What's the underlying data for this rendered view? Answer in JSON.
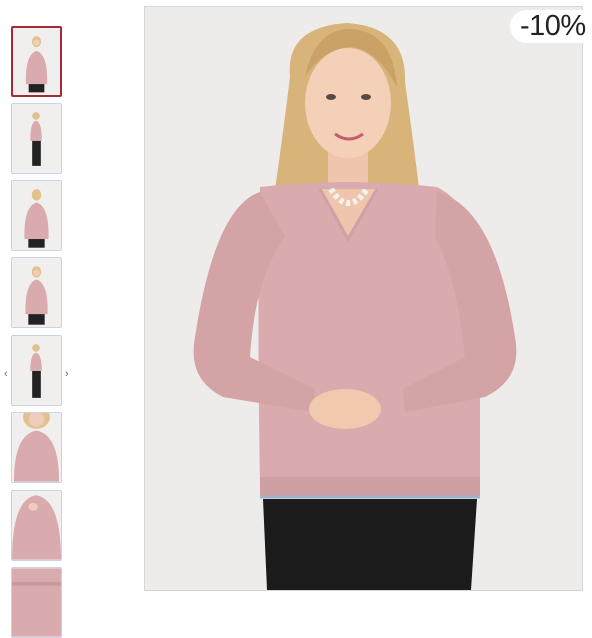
{
  "gallery": {
    "thumbnails": [
      {
        "alt": "thumb-1",
        "active": true
      },
      {
        "alt": "thumb-2",
        "active": false
      },
      {
        "alt": "thumb-3",
        "active": false
      },
      {
        "alt": "thumb-4",
        "active": false
      },
      {
        "alt": "thumb-5",
        "active": false
      },
      {
        "alt": "thumb-6",
        "active": false
      },
      {
        "alt": "thumb-7",
        "active": false
      },
      {
        "alt": "thumb-8",
        "active": false
      }
    ],
    "prev_arrow": "‹",
    "next_arrow": "›"
  },
  "product": {
    "discount_badge": "-10%"
  },
  "colors": {
    "sweater": "#d9abae",
    "background": "#eeeceb",
    "active_border": "#a62a35"
  }
}
